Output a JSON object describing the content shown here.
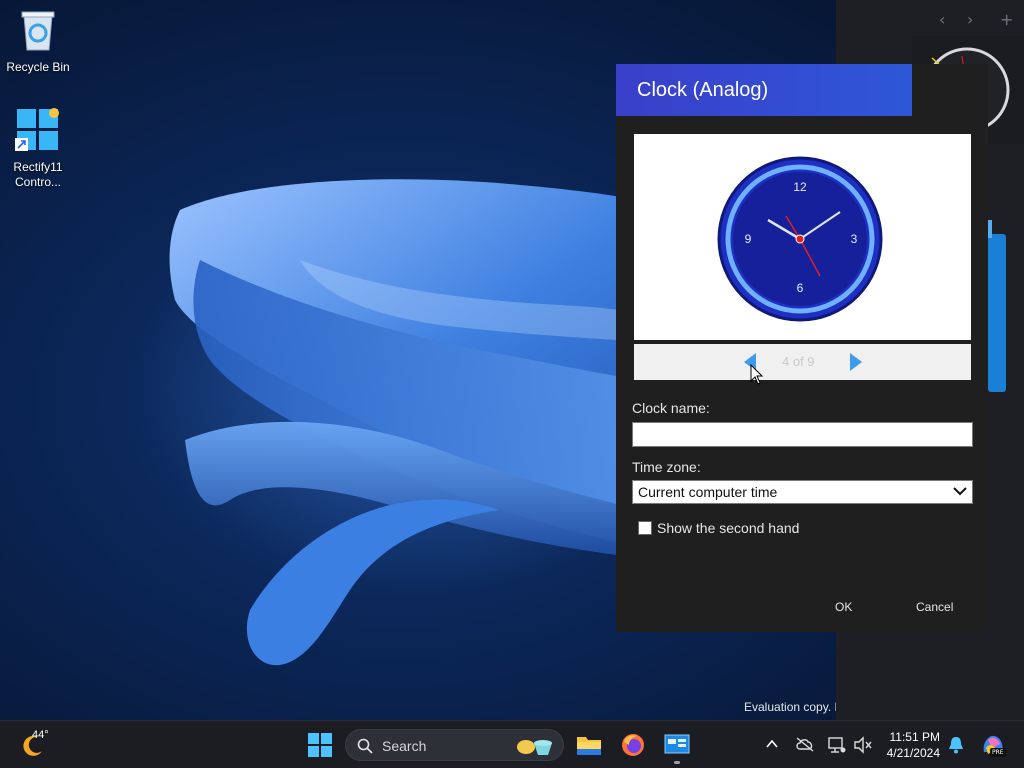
{
  "desktop": {
    "icons": [
      {
        "label": "Recycle Bin"
      },
      {
        "label_line1": "Rectify11",
        "label_line2": "Contro..."
      }
    ],
    "watermark": "Evaluation copy. E"
  },
  "gadget_strip": {
    "prev_glyph": "‹",
    "next_glyph": "›",
    "add_glyph": "+"
  },
  "dialog": {
    "title": "Clock (Analog)",
    "preview_clock_numbers": [
      "12",
      "3",
      "6",
      "9"
    ],
    "pager": {
      "text": "4 of 9"
    },
    "clock_name_label": "Clock name:",
    "clock_name_value": "",
    "time_zone_label": "Time zone:",
    "time_zone_value": "Current computer time",
    "second_hand_label": "Show the second hand",
    "second_hand_checked": false,
    "ok_label": "OK",
    "cancel_label": "Cancel",
    "accent_color": "#3a3fc9"
  },
  "taskbar": {
    "weather_temp": "44°",
    "search_placeholder": "Search",
    "time": "11:51 PM",
    "date": "4/21/2024",
    "copilot_badge": "PRE"
  }
}
